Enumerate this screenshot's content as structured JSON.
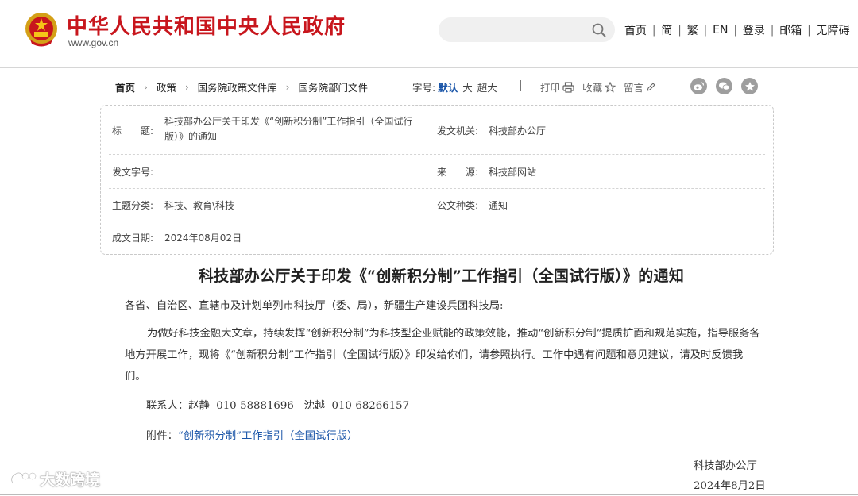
{
  "site": {
    "title": "中华人民共和国中央人民政府",
    "url": "www.gov.cn"
  },
  "search": {
    "placeholder": "",
    "value": ""
  },
  "top_nav": [
    "首页",
    "简",
    "繁",
    "EN",
    "登录",
    "邮箱",
    "无障碍"
  ],
  "breadcrumb": [
    "首页",
    "政策",
    "国务院政策文件库",
    "国务院部门文件"
  ],
  "font_size": {
    "label": "字号:",
    "options": [
      "默认",
      "大",
      "超大"
    ],
    "selected": "默认"
  },
  "tools": {
    "print": "打印",
    "favorite": "收藏",
    "comment": "留言"
  },
  "share_icons": [
    "weibo-icon",
    "wechat-icon",
    "qzone-icon"
  ],
  "info": {
    "title_label": "标　　题:",
    "title_value": "科技部办公厅关于印发《“创新积分制”工作指引（全国试行版）》的通知",
    "issuer_label": "发文机关:",
    "issuer_value": "科技部办公厅",
    "doc_no_label": "发文字号:",
    "doc_no_value": "",
    "source_label": "来　　源:",
    "source_value": "科技部网站",
    "topic_label": "主题分类:",
    "topic_value": "科技、教育\\科技",
    "type_label": "公文种类:",
    "type_value": "通知",
    "date_label": "成文日期:",
    "date_value": "2024年08月02日"
  },
  "article": {
    "title": "科技部办公厅关于印发《“创新积分制”工作指引（全国试行版）》的通知",
    "addressee": "各省、自治区、直辖市及计划单列市科技厅（委、局），新疆生产建设兵团科技局:",
    "body": "为做好科技金融大文章，持续发挥“创新积分制”为科技型企业赋能的政策效能，推动“创新积分制”提质扩面和规范实施，指导服务各地方开展工作，现将《“创新积分制”工作指引（全国试行版）》印发给你们，请参照执行。工作中遇有问题和意见建议，请及时反馈我们。",
    "contact": "联系人：赵静  010-58881696   沈越  010-68266157",
    "attachment_label": "附件：",
    "attachment_link": "“创新积分制”工作指引（全国试行版）",
    "sign_org": "科技部办公厅",
    "sign_date": "2024年8月2日"
  },
  "watermark": "大数跨境",
  "colors": {
    "brand_red": "#c8161d",
    "link_blue": "#1a55a8"
  }
}
